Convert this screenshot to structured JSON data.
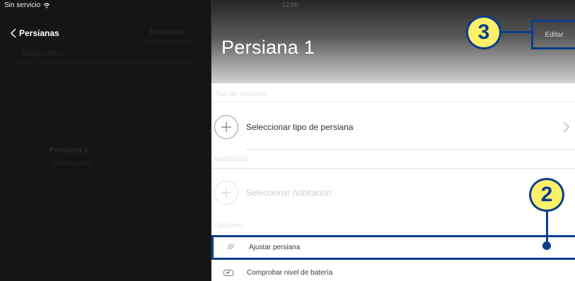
{
  "status_bar": {
    "carrier": "Sin servicio"
  },
  "sidebar": {
    "back_label": "Persianas",
    "right_label": "Persianas",
    "subheading": "Dispositivos",
    "item_title": "Persiana 1",
    "item_subtitle": "Sin habitación"
  },
  "header": {
    "top_text": "12:00",
    "title": "Persiana 1",
    "edit_label": "Editar"
  },
  "sections": {
    "type_label": "Tipo de persiana",
    "select_type": "Seleccionar tipo de persiana",
    "room_label": "Habitación",
    "select_room": "Seleccionar habitación",
    "options_label": "Opciones",
    "adjust": "Ajustar persiana",
    "adjust_icon_text": "///",
    "battery": "Comprobar nivel de batería"
  },
  "callouts": {
    "edit": "3",
    "adjust": "2"
  },
  "colors": {
    "accent": "#0a3e8c",
    "callout_fill": "#fff06a"
  }
}
